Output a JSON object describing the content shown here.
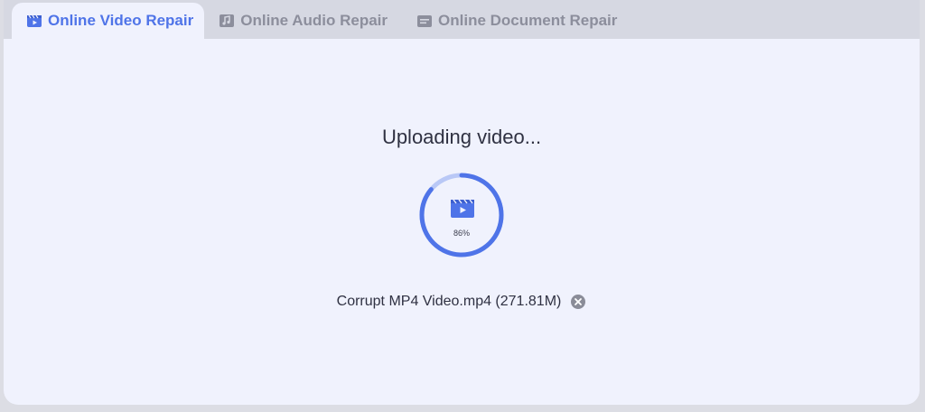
{
  "tabs": [
    {
      "label": "Online Video Repair",
      "icon": "video-clapper-icon",
      "active": true
    },
    {
      "label": "Online Audio Repair",
      "icon": "music-note-icon",
      "active": false
    },
    {
      "label": "Online Document Repair",
      "icon": "document-icon",
      "active": false
    }
  ],
  "upload": {
    "status": "Uploading video...",
    "progress_label": "86%",
    "progress": 0.86,
    "file_name": "Corrupt MP4 Video.mp4 (271.81M)"
  },
  "colors": {
    "accent": "#4f74e8",
    "ring_track": "#b9c8f6",
    "panel_bg": "#f0f2fd",
    "tab_bar_bg": "#d6d8e2",
    "inactive_tab": "#8c8e9c"
  }
}
